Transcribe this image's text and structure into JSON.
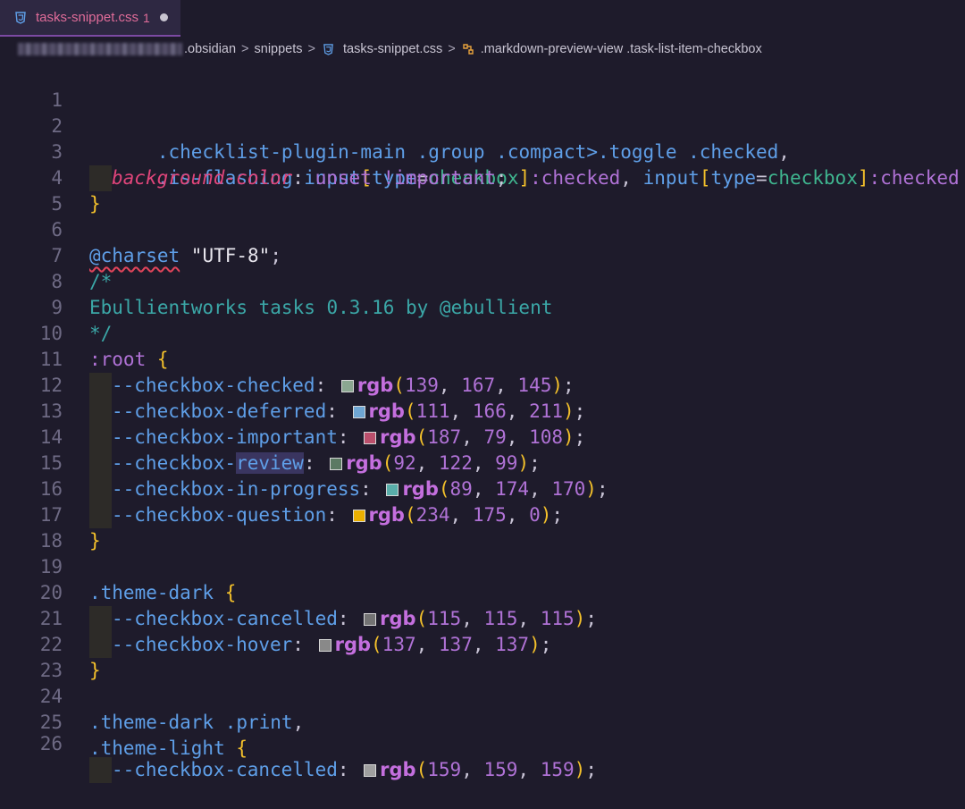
{
  "tab": {
    "title": "tasks-snippet.css",
    "problems": "1",
    "icon": "css3-icon"
  },
  "breadcrumb": {
    "folder1": ".obsidian",
    "folder2": "snippets",
    "file": "tasks-snippet.css",
    "symbol": ".markdown-preview-view .task-list-item-checkbox",
    "sep": ">"
  },
  "lines": [
    {
      "n": "1",
      "t": [
        [
          ".checklist-plugin-main",
          ".group",
          ".compact",
          ">",
          ".toggle",
          ".checked",
          ","
        ]
      ]
    },
    {
      "n": "2"
    },
    {
      "n": "3"
    },
    {
      "n": "4"
    },
    {
      "n": "5"
    },
    {
      "n": "6"
    },
    {
      "n": "7"
    },
    {
      "n": "8"
    },
    {
      "n": "9"
    },
    {
      "n": "10"
    },
    {
      "n": "11"
    },
    {
      "n": "12"
    },
    {
      "n": "13"
    },
    {
      "n": "14"
    },
    {
      "n": "15"
    },
    {
      "n": "16"
    },
    {
      "n": "17"
    },
    {
      "n": "18"
    },
    {
      "n": "19"
    },
    {
      "n": "20"
    },
    {
      "n": "21"
    },
    {
      "n": "22"
    },
    {
      "n": "23"
    },
    {
      "n": "24"
    },
    {
      "n": "25"
    },
    {
      "n": "26"
    }
  ],
  "code": {
    "l1": {
      "a": ".checklist-plugin-main",
      "b": " .group",
      "c": " .compact",
      "d": ">",
      "e": ".toggle",
      "f": " .checked",
      "g": ","
    },
    "l2": {
      "a": ".is-flashing",
      "b": " input",
      "c": "[",
      "d": "type",
      "e": "=",
      "f": "checkbox",
      "g": "]",
      "h": ":checked",
      "i": ", ",
      "j": "input",
      "k": "[",
      "l": "type",
      "m": "=",
      "n": "checkbox",
      "o": "]",
      "p": ":checked",
      "q": " {"
    },
    "l3": {
      "a": "background-color",
      "b": ": ",
      "c": "unset",
      "d": " !important",
      "e": ";"
    },
    "l4": {
      "a": "}"
    },
    "l6": {
      "a": "@charset",
      "b": " \"UTF-8\"",
      "c": ";"
    },
    "l7": {
      "a": "/*"
    },
    "l8": {
      "a": "Ebullientworks tasks 0.3.16 by @ebullient"
    },
    "l9": {
      "a": "*/"
    },
    "l10": {
      "a": ":root",
      "b": " {"
    },
    "l17": {
      "a": "}"
    },
    "l19": {
      "a": ".theme-dark",
      "b": " {"
    },
    "l22": {
      "a": "}"
    },
    "l24": {
      "a": ".theme-dark",
      "b": " .print",
      "c": ","
    },
    "l25": {
      "a": ".theme-light",
      "b": " {"
    }
  },
  "vars": [
    {
      "line": "11",
      "name": "--checkbox-checked",
      "fn": "rgb",
      "r": "139",
      "g": "167",
      "b": "145",
      "swatch": "#8ba791"
    },
    {
      "line": "12",
      "name": "--checkbox-deferred",
      "fn": "rgb",
      "r": "111",
      "g": "166",
      "b": "211",
      "swatch": "#6fa6d3"
    },
    {
      "line": "13",
      "name": "--checkbox-important",
      "fn": "rgb",
      "r": "187",
      "g": "79",
      "b": "108",
      "swatch": "#bb4f6c"
    },
    {
      "line": "14",
      "name_a": "--checkbox-",
      "name_b": "review",
      "fn": "rgb",
      "r": "92",
      "g": "122",
      "b": "99",
      "swatch": "#5c7a63"
    },
    {
      "line": "15",
      "name": "--checkbox-in-progress",
      "fn": "rgb",
      "r": "89",
      "g": "174",
      "b": "170",
      "swatch": "#59aeaa"
    },
    {
      "line": "16",
      "name": "--checkbox-question",
      "fn": "rgb",
      "r": "234",
      "g": "175",
      "b": "0",
      "swatch": "#eaaf00"
    },
    {
      "line": "20",
      "name": "--checkbox-cancelled",
      "fn": "rgb",
      "r": "115",
      "g": "115",
      "b": "115",
      "swatch": "#737373"
    },
    {
      "line": "21",
      "name": "--checkbox-hover",
      "fn": "rgb",
      "r": "137",
      "g": "137",
      "b": "137",
      "swatch": "#898989"
    },
    {
      "line": "26",
      "name": "--checkbox-cancelled",
      "fn": "rgb",
      "r": "159",
      "g": "159",
      "b": "159",
      "swatch": "#9f9f9f"
    }
  ],
  "punct": {
    "open": "(",
    "comma": ", ",
    "close": ")",
    "semi": ";",
    "colon": ": "
  }
}
